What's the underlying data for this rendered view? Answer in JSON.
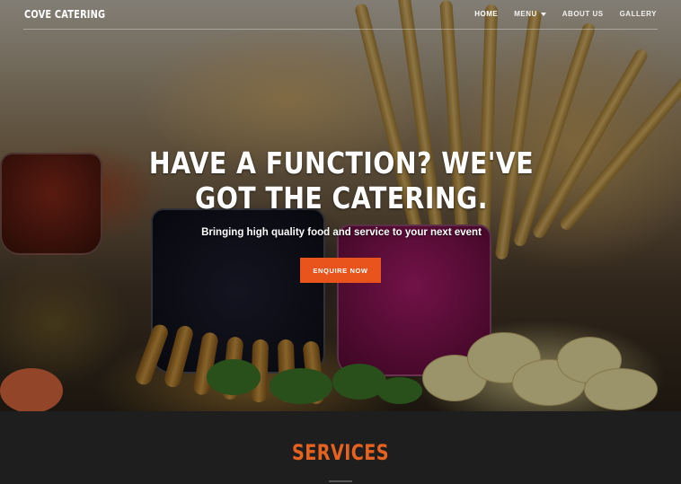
{
  "nav": {
    "brand": "COVE CATERING",
    "links": [
      {
        "label": "HOME"
      },
      {
        "label": "MENU"
      },
      {
        "label": "ABOUT US"
      },
      {
        "label": "GALLERY"
      }
    ]
  },
  "hero": {
    "headline": "HAVE A FUNCTION? WE'VE GOT THE CATERING.",
    "subheadline": "Bringing high quality food and service to your next event",
    "cta_label": "ENQUIRE NOW"
  },
  "services": {
    "title": "SERVICES"
  },
  "colors": {
    "accent": "#e8541c",
    "services_title": "#e5621f",
    "dark_background": "#1e1e1e"
  },
  "icons": {
    "menu_dropdown": "chevron-down-icon"
  }
}
